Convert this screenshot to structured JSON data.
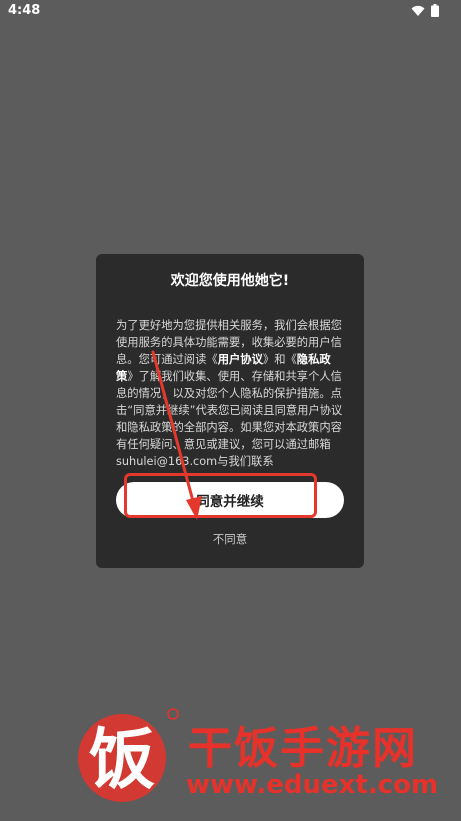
{
  "status_bar": {
    "time": "4:48",
    "icons": [
      "wifi-icon",
      "battery-icon"
    ]
  },
  "dialog": {
    "title": "欢迎您使用他她它!",
    "body": [
      {
        "text": "为了更好地为您提供相关服务，我们会根据您使用服务的具体功能需要，收集必要的用户信息。您可通过阅读《"
      },
      {
        "text": "用户协议",
        "bold": true
      },
      {
        "text": "》和《"
      },
      {
        "text": "隐私政策",
        "bold": true
      },
      {
        "text": "》了解我们收集、使用、存储和共享个人信息的情况，以及对您个人隐私的保护措施。点击“同意并继续”代表您已阅读且同意用户协议和隐私政策的全部内容。如果您对本政策内容有任何疑问、意见或建议，您可以通过邮箱\nsuhulei@163.com与我们联系"
      }
    ],
    "agree_label": "同意并继续",
    "disagree_label": "不同意"
  },
  "watermark": {
    "logo_char": "饭",
    "title": "干饭手游网",
    "url": "www.eduext.com"
  },
  "colors": {
    "background": "#5c5c5c",
    "dialog": "#2b2b2b",
    "annotation_red": "#e4382c"
  }
}
